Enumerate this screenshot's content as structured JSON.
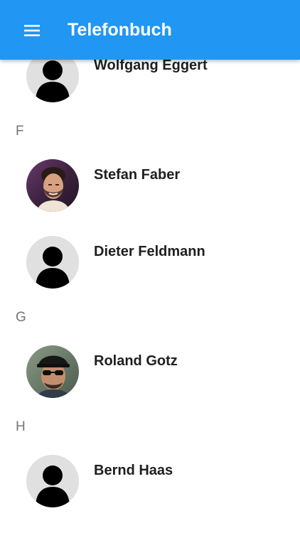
{
  "app_bar": {
    "menu_icon": "menu-icon",
    "title": "Telefonbuch",
    "background": "#2196f3"
  },
  "contacts_list": {
    "first_contact": {
      "name": "Wolfgang Eggert",
      "avatar": "person-placeholder-icon"
    },
    "sections": [
      {
        "letter": "F",
        "contacts": [
          {
            "name": "Stefan Faber",
            "avatar": "photo"
          },
          {
            "name": "Dieter Feldmann",
            "avatar": "person-placeholder-icon"
          }
        ]
      },
      {
        "letter": "G",
        "contacts": [
          {
            "name": "Roland Gotz",
            "avatar": "photo"
          }
        ]
      },
      {
        "letter": "H",
        "contacts": [
          {
            "name": "Bernd Haas",
            "avatar": "person-placeholder-icon"
          }
        ]
      }
    ]
  }
}
